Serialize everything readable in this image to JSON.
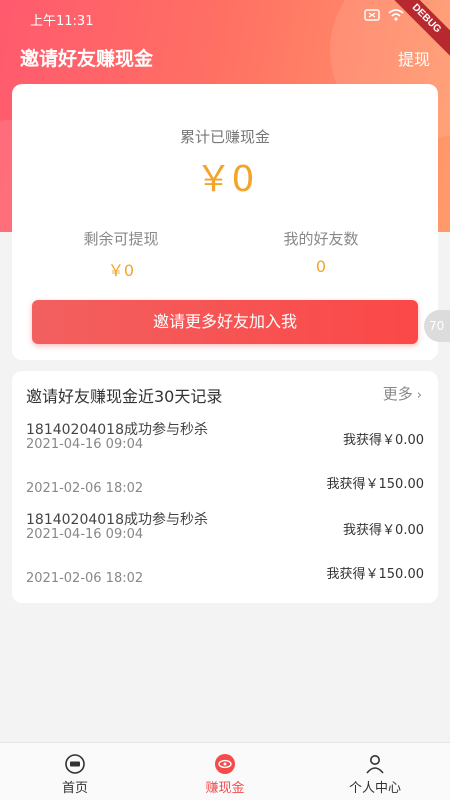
{
  "status_bar": {
    "time": "上午11:31",
    "debug_label": "DEBUG"
  },
  "header": {
    "title": "邀请好友赚现金",
    "withdraw_label": "提现"
  },
  "summary": {
    "total_label": "累计已赚现金",
    "total_amount": "￥0",
    "remaining_label": "剩余可提现",
    "remaining_value": "￥0",
    "friends_label": "我的好友数",
    "friends_value": "0",
    "invite_button": "邀请更多好友加入我"
  },
  "side_float": {
    "label": "70"
  },
  "records": {
    "title": "邀请好友赚现金近30天记录",
    "more_label": "更多",
    "items": [
      {
        "title": "18140204018成功参与秒杀",
        "date": "2021-04-16 09:04",
        "gain": "我获得￥0.00"
      },
      {
        "title": "",
        "date": "2021-02-06 18:02",
        "gain": "我获得￥150.00"
      },
      {
        "title": "18140204018成功参与秒杀",
        "date": "2021-04-16 09:04",
        "gain": "我获得￥0.00"
      },
      {
        "title": "",
        "date": "2021-02-06 18:02",
        "gain": "我获得￥150.00"
      }
    ]
  },
  "tabbar": {
    "tabs": [
      {
        "label": "首页",
        "icon": "home-seckill-icon",
        "active": false
      },
      {
        "label": "赚现金",
        "icon": "eye-coin-icon",
        "active": true
      },
      {
        "label": "个人中心",
        "icon": "person-icon",
        "active": false
      }
    ]
  },
  "colors": {
    "header_gradient_start": "#ff5a6e",
    "header_gradient_end": "#ff9a6a",
    "amount_color": "#f2a42b",
    "button_color": "#f2605f",
    "active_tab_color": "#f44b4b"
  }
}
